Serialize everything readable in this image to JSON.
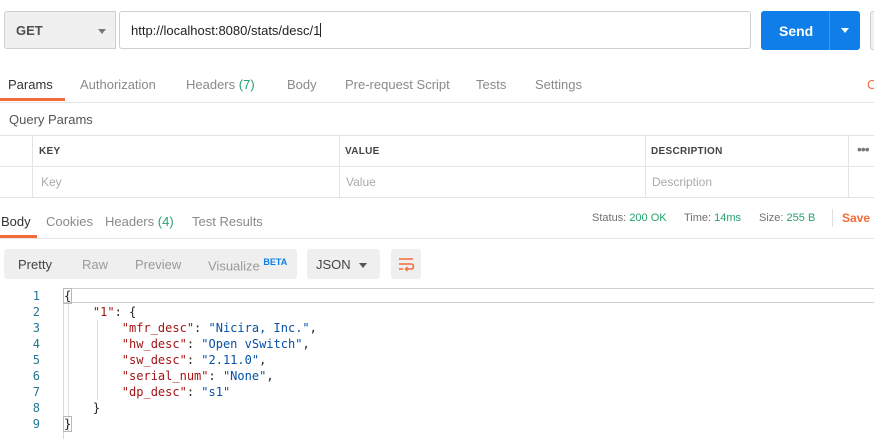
{
  "request": {
    "method": "GET",
    "url": "http://localhost:8080/stats/desc/1",
    "send_label": "Send"
  },
  "request_tabs": [
    {
      "label": "Params",
      "active": true
    },
    {
      "label": "Authorization"
    },
    {
      "label": "Headers",
      "count": "(7)"
    },
    {
      "label": "Body"
    },
    {
      "label": "Pre-request Script"
    },
    {
      "label": "Tests"
    },
    {
      "label": "Settings"
    }
  ],
  "query_params": {
    "title": "Query Params",
    "headers": [
      "KEY",
      "VALUE",
      "DESCRIPTION"
    ],
    "placeholders": [
      "Key",
      "Value",
      "Description"
    ],
    "more": "•••"
  },
  "response_tabs": [
    {
      "label": "Body",
      "active": true
    },
    {
      "label": "Cookies"
    },
    {
      "label": "Headers",
      "count": "(4)"
    },
    {
      "label": "Test Results"
    }
  ],
  "response_meta": {
    "status_label": "Status:",
    "status_value": "200 OK",
    "time_label": "Time:",
    "time_value": "14ms",
    "size_label": "Size:",
    "size_value": "255 B",
    "save_label": "Save R"
  },
  "viewer": {
    "modes": [
      "Pretty",
      "Raw",
      "Preview",
      "Visualize"
    ],
    "beta": "BETA",
    "format": "JSON"
  },
  "code": {
    "line_numbers": [
      "1",
      "2",
      "3",
      "4",
      "5",
      "6",
      "7",
      "8",
      "9"
    ],
    "root_key": "\"1\"",
    "fields": [
      {
        "key": "\"mfr_desc\"",
        "value": "\"Nicira, Inc.\""
      },
      {
        "key": "\"hw_desc\"",
        "value": "\"Open vSwitch\""
      },
      {
        "key": "\"sw_desc\"",
        "value": "\"2.11.0\""
      },
      {
        "key": "\"serial_num\"",
        "value": "\"None\""
      },
      {
        "key": "\"dp_desc\"",
        "value": "\"s1\""
      }
    ]
  },
  "colors": {
    "accent": "#f26b3a",
    "send": "#0f7ee8",
    "ok": "#26a36a"
  }
}
